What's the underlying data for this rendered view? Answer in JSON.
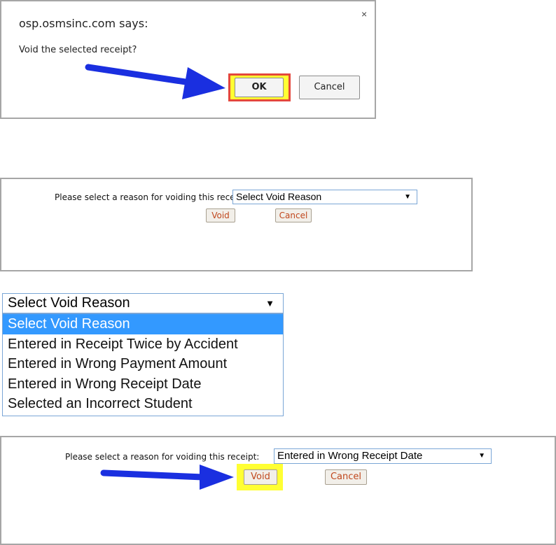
{
  "dialog": {
    "site": "osp.osmsinc.com says:",
    "message": "Void the selected receipt?",
    "ok_label": "OK",
    "cancel_label": "Cancel",
    "close_glyph": "×"
  },
  "form1": {
    "prompt": "Please select a reason for voiding this receipt:",
    "select_value": "Select Void Reason",
    "void_label": "Void",
    "cancel_label": "Cancel"
  },
  "dropdown": {
    "select_value": "Select Void Reason",
    "options": [
      "Select Void Reason",
      "Entered in Receipt Twice by Accident",
      "Entered in Wrong Payment Amount",
      "Entered in Wrong Receipt Date",
      "Selected an Incorrect Student"
    ],
    "selected_index": 0
  },
  "form2": {
    "prompt": "Please select a reason for voiding this receipt:",
    "select_value": "Entered in Wrong Receipt Date",
    "void_label": "Void",
    "cancel_label": "Cancel"
  },
  "colors": {
    "highlight": "#ffff33",
    "highlight_border": "#e4473c",
    "arrow_blue": "#1a2fe0",
    "option_selected": "#3399ff"
  },
  "icons": {
    "close": "close-icon",
    "dropdown": "dropdown-arrow-icon",
    "pointer": "pointer-arrow-icon"
  }
}
